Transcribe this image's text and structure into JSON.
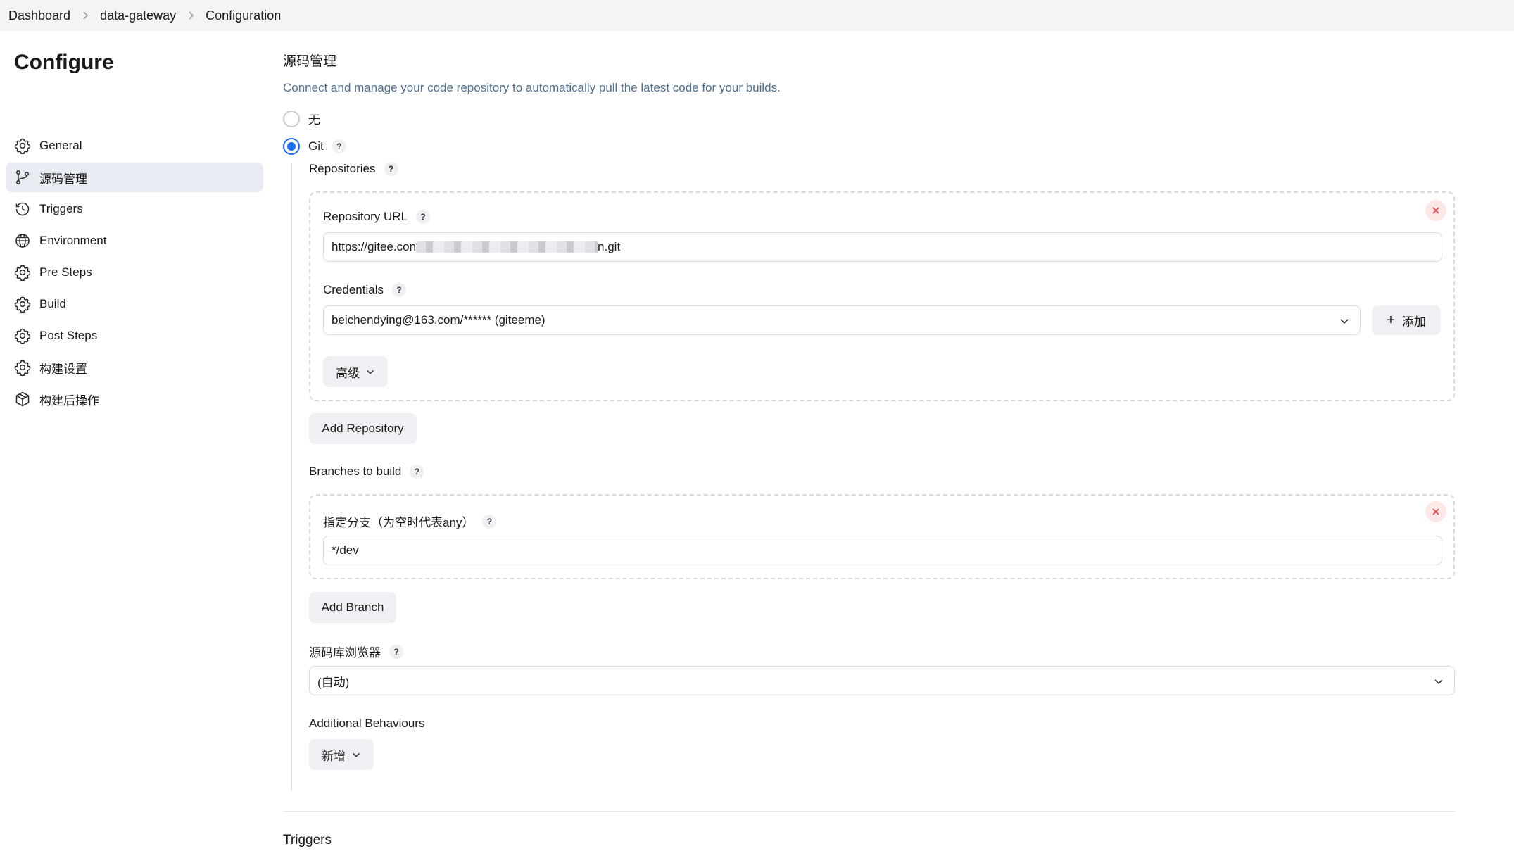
{
  "breadcrumb": [
    "Dashboard",
    "data-gateway",
    "Configuration"
  ],
  "page_title": "Configure",
  "sidebar": {
    "items": [
      {
        "label": "General",
        "icon": "gear-icon",
        "active": false
      },
      {
        "label": "源码管理",
        "icon": "branch-icon",
        "active": true
      },
      {
        "label": "Triggers",
        "icon": "clock-icon",
        "active": false
      },
      {
        "label": "Environment",
        "icon": "globe-icon",
        "active": false
      },
      {
        "label": "Pre Steps",
        "icon": "gear-icon",
        "active": false
      },
      {
        "label": "Build",
        "icon": "gear-icon",
        "active": false
      },
      {
        "label": "Post Steps",
        "icon": "gear-icon",
        "active": false
      },
      {
        "label": "构建设置",
        "icon": "gear-icon",
        "active": false
      },
      {
        "label": "构建后操作",
        "icon": "package-icon",
        "active": false
      }
    ]
  },
  "scm": {
    "title": "源码管理",
    "description": "Connect and manage your code repository to automatically pull the latest code for your builds.",
    "options": [
      {
        "label": "无",
        "selected": false
      },
      {
        "label": "Git",
        "selected": true
      }
    ],
    "repositories_label": "Repositories",
    "repo": {
      "url_label": "Repository URL",
      "url_prefix": "https://gitee.con",
      "url_suffix": "n.git",
      "credentials_label": "Credentials",
      "credentials_value": "beichendying@163.com/****** (giteeme)",
      "add_button": "添加",
      "advanced_button": "高级"
    },
    "add_repository_button": "Add Repository",
    "branches_label": "Branches to build",
    "branch": {
      "spec_label": "指定分支（为空时代表any）",
      "spec_value": "*/dev"
    },
    "add_branch_button": "Add Branch",
    "browser_label": "源码库浏览器",
    "browser_value": "(自动)",
    "additional_label": "Additional Behaviours",
    "additional_button": "新增"
  },
  "next_section_title": "Triggers",
  "colors": {
    "accent": "#1f6feb",
    "description": "#4f6f8f",
    "active_nav": "#e8ebf1",
    "delete_bg": "#fde8e8",
    "delete_fg": "#e5484d"
  }
}
